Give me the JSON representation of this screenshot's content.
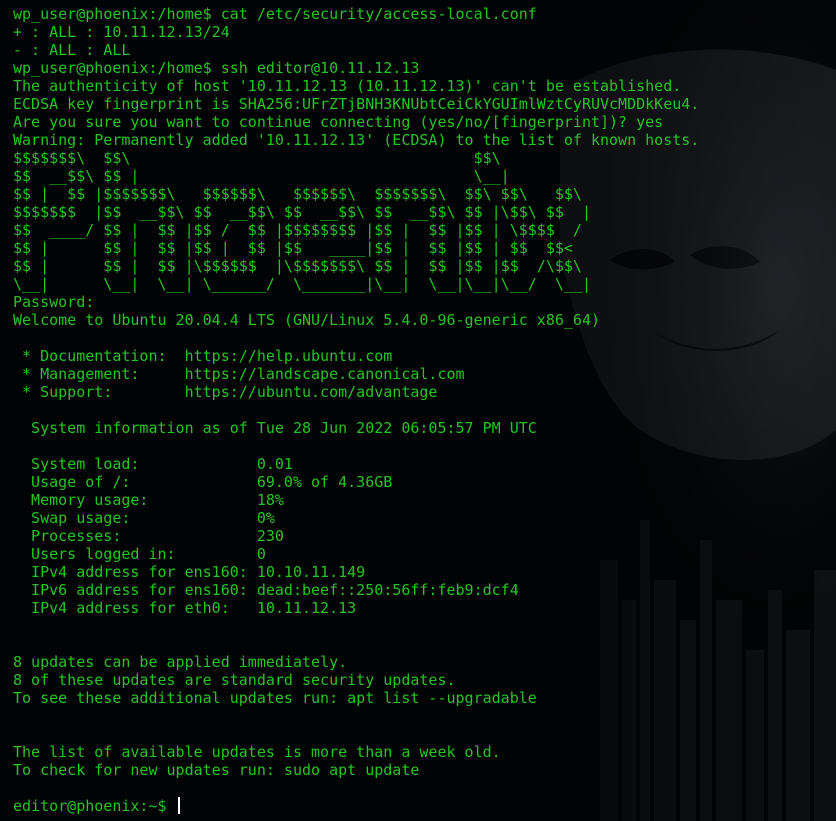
{
  "terminal": {
    "colors": {
      "background": "#020304",
      "text": "#25c325",
      "cursor": "#ffffff"
    },
    "lines": [
      "wp_user@phoenix:/home$ cat /etc/security/access-local.conf",
      "+ : ALL : 10.11.12.13/24",
      "- : ALL : ALL",
      "wp_user@phoenix:/home$ ssh editor@10.11.12.13",
      "The authenticity of host '10.11.12.13 (10.11.12.13)' can't be established.",
      "ECDSA key fingerprint is SHA256:UFrZTjBNH3KNUbtCeiCkYGUImlWztCyRUVcMDDkKeu4.",
      "Are you sure you want to continue connecting (yes/no/[fingerprint])? yes",
      "Warning: Permanently added '10.11.12.13' (ECDSA) to the list of known hosts.",
      "$$$$$$$\\  $$\\                                      $$\\",
      "$$  __$$\\ $$ |                                     \\__|",
      "$$ |  $$ |$$$$$$$\\   $$$$$$\\   $$$$$$\\  $$$$$$$\\  $$\\ $$\\   $$\\",
      "$$$$$$$  |$$  __$$\\ $$  __$$\\ $$  __$$\\ $$  __$$\\ $$ |\\$$\\ $$  |",
      "$$  ____/ $$ |  $$ |$$ /  $$ |$$$$$$$$ |$$ |  $$ |$$ | \\$$$$  /",
      "$$ |      $$ |  $$ |$$ |  $$ |$$   ____|$$ |  $$ |$$ | $$  $$<",
      "$$ |      $$ |  $$ |\\$$$$$$  |\\$$$$$$$\\ $$ |  $$ |$$ |$$  /\\$$\\",
      "\\__|      \\__|  \\__| \\______/  \\_______|\\__|  \\__|\\__|\\__/  \\__|",
      "Password:",
      "Welcome to Ubuntu 20.04.4 LTS (GNU/Linux 5.4.0-96-generic x86_64)",
      "",
      " * Documentation:  https://help.ubuntu.com",
      " * Management:     https://landscape.canonical.com",
      " * Support:        https://ubuntu.com/advantage",
      "",
      "  System information as of Tue 28 Jun 2022 06:05:57 PM UTC",
      "",
      "  System load:             0.01",
      "  Usage of /:              69.0% of 4.36GB",
      "  Memory usage:            18%",
      "  Swap usage:              0%",
      "  Processes:               230",
      "  Users logged in:         0",
      "  IPv4 address for ens160: 10.10.11.149",
      "  IPv6 address for ens160: dead:beef::250:56ff:feb9:dcf4",
      "  IPv4 address for eth0:   10.11.12.13",
      "",
      "",
      "8 updates can be applied immediately.",
      "8 of these updates are standard security updates.",
      "To see these additional updates run: apt list --upgradable",
      "",
      "",
      "The list of available updates is more than a week old.",
      "To check for new updates run: sudo apt update",
      ""
    ],
    "prompt": "editor@phoenix:~$ "
  }
}
